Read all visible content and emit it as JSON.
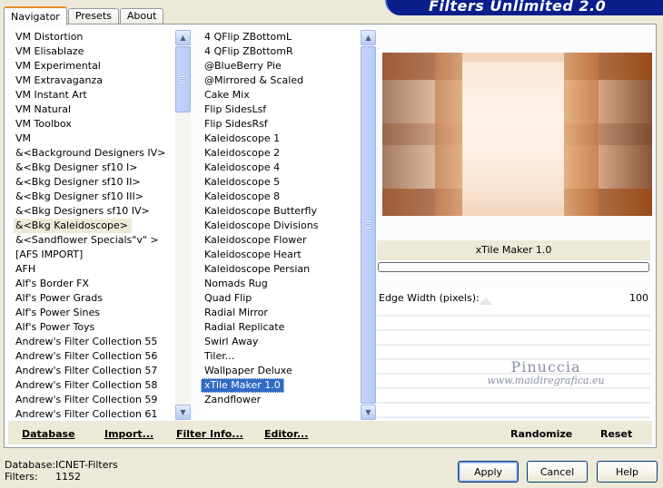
{
  "banner": {
    "title": "Filters Unlimited 2.0"
  },
  "tabs": [
    {
      "label": "Navigator",
      "active": true
    },
    {
      "label": "Presets",
      "active": false
    },
    {
      "label": "About",
      "active": false
    }
  ],
  "categories": [
    "VM Distortion",
    "VM Elisablaze",
    "VM Experimental",
    "VM Extravaganza",
    "VM Instant Art",
    "VM Natural",
    "VM Toolbox",
    "VM",
    "&<Background Designers IV>",
    "&<Bkg Designer sf10 I>",
    "&<Bkg Designer sf10 II>",
    "&<Bkg Designer sf10 III>",
    "&<Bkg Designers sf10 IV>",
    "&<Bkg Kaleidoscope>",
    "&<Sandflower Specials\"v\" >",
    "[AFS IMPORT]",
    "AFH",
    "Alf's Border FX",
    "Alf's Power Grads",
    "Alf's Power Sines",
    "Alf's Power Toys",
    "Andrew's Filter Collection 55",
    "Andrew's Filter Collection 56",
    "Andrew's Filter Collection 57",
    "Andrew's Filter Collection 58",
    "Andrew's Filter Collection 59",
    "Andrew's Filter Collection 61"
  ],
  "selected_category_index": 13,
  "filters": [
    "4 QFlip ZBottomL",
    "4 QFlip ZBottomR",
    "@BlueBerry Pie",
    "@Mirrored & Scaled",
    "Cake Mix",
    "Flip SidesLsf",
    "Flip SidesRsf",
    "Kaleidoscope 1",
    "Kaleidoscope 2",
    "Kaleidoscope 4",
    "Kaleidoscope 5",
    "Kaleidoscope 8",
    "Kaleidoscope Butterfly",
    "Kaleidoscope Divisions",
    "Kaleidoscope Flower",
    "Kaleidoscope Heart",
    "Kaleidoscope Persian",
    "Nomads Rug",
    "Quad Flip",
    "Radial Mirror",
    "Radial Replicate",
    "Swirl Away",
    "Tiler...",
    "Wallpaper Deluxe",
    "xTile Maker 1.0",
    "Zandflower"
  ],
  "selected_filter_index": 24,
  "filter_title": "xTile Maker 1.0",
  "parameters": [
    {
      "label": "Edge Width (pixels):",
      "value": "100"
    }
  ],
  "watermark": {
    "name": "Pinuccia",
    "url": "www.maidiregrafica.eu"
  },
  "toolbar": {
    "database": "Database",
    "import": "Import...",
    "filter_info": "Filter Info...",
    "editor": "Editor...",
    "randomize": "Randomize",
    "reset": "Reset"
  },
  "status": {
    "database_label": "Database:",
    "database_value": "ICNET-Filters",
    "filters_label": "Filters:",
    "filters_value": "1152"
  },
  "buttons": {
    "apply": "Apply",
    "cancel": "Cancel",
    "help": "Help"
  },
  "colors": {
    "selection": "#316ac5",
    "banner": "#0a1e8c",
    "tab_accent": "#e68b2c"
  }
}
